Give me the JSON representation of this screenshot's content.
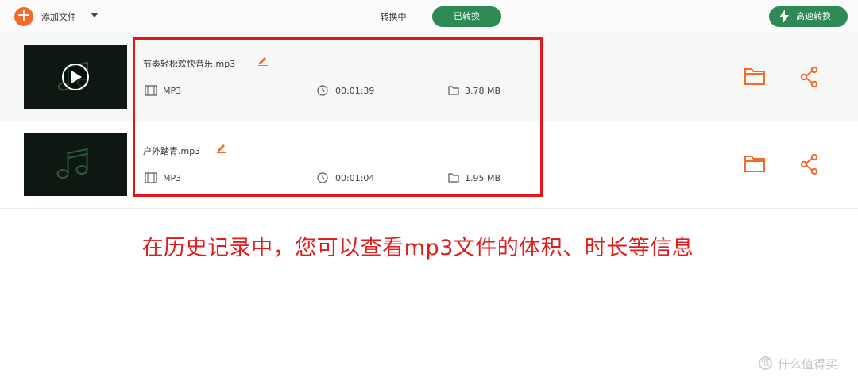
{
  "toolbar": {
    "add_icon": "plus-icon",
    "add_label": "添加文件",
    "tabs": [
      {
        "label": "转换中",
        "active": false
      },
      {
        "label": "已转换",
        "active": true
      }
    ],
    "turbo_label": "高速转换",
    "accent_green": "#2d8a55",
    "accent_orange": "#f26b2c"
  },
  "files": [
    {
      "name": "节奏轻松欢快音乐.mp3",
      "format": "MP3",
      "duration": "00:01:39",
      "size": "3.78 MB",
      "thumb_icon": "play-icon"
    },
    {
      "name": "户外踏青.mp3",
      "format": "MP3",
      "duration": "00:01:04",
      "size": "1.95 MB",
      "thumb_icon": "music-note-icon"
    }
  ],
  "annotation": {
    "caption": "在历史记录中，您可以查看mp3文件的体积、时长等信息",
    "highlight_color": "#e5151a"
  },
  "watermark": {
    "icon_text": "值",
    "text": "什么值得买"
  }
}
